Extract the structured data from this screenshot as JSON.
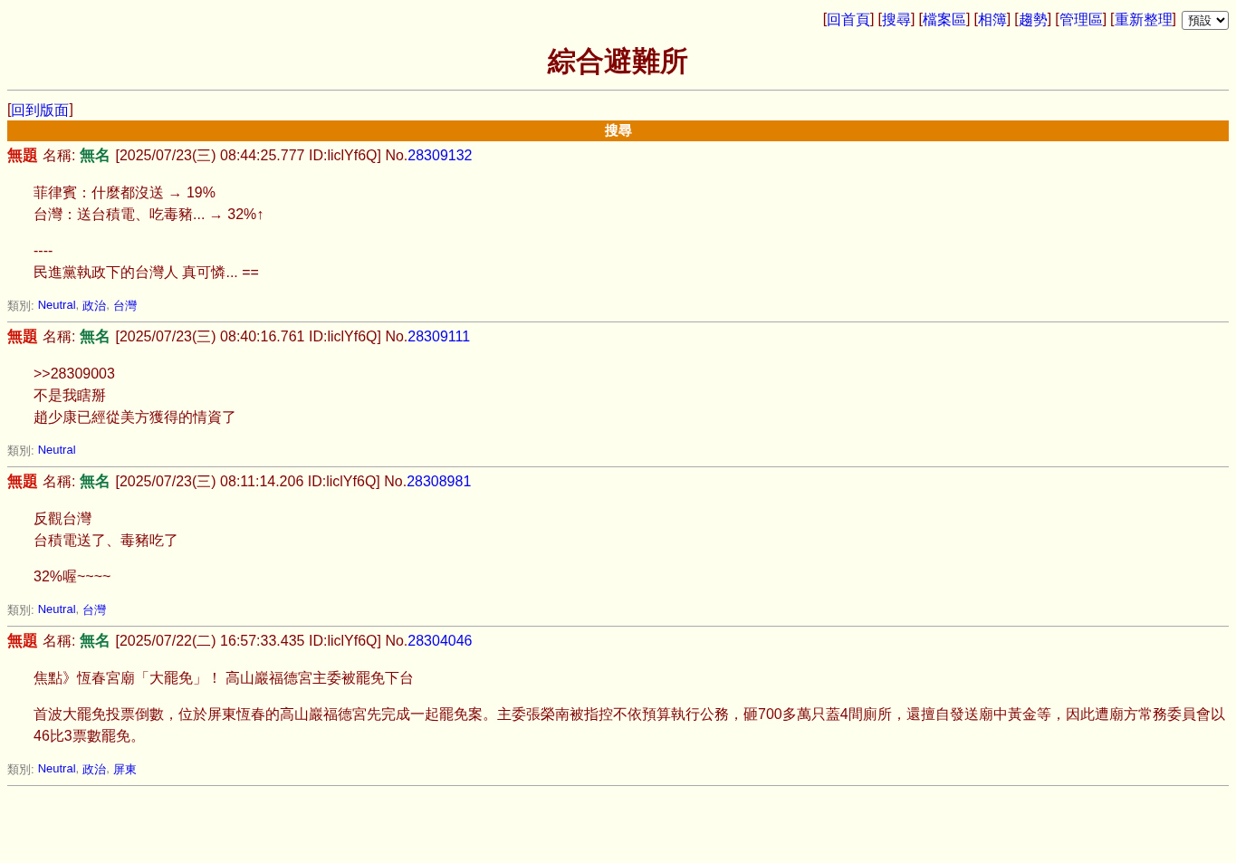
{
  "nav": {
    "links": [
      {
        "left": "[",
        "label": "回首頁",
        "right": "]"
      },
      {
        "left": "[",
        "label": "搜尋",
        "right": "]"
      },
      {
        "left": "[",
        "label": "檔案區",
        "right": "]"
      },
      {
        "left": "[",
        "label": "相簿",
        "right": "]"
      },
      {
        "left": "[",
        "label": "趨勢",
        "right": "]"
      },
      {
        "left": "[",
        "label": "管理區",
        "right": "]"
      },
      {
        "left": "[",
        "label": "重新整理",
        "right": "]"
      }
    ],
    "style_select": {
      "value": "預設"
    }
  },
  "title": "綜合避難所",
  "back": {
    "left": "[",
    "label": "回到版面",
    "right": "]"
  },
  "bar_title": "搜尋",
  "posts": [
    {
      "subject": "無題",
      "name_label": "名稱:",
      "name": "無名",
      "meta": "[2025/07/23(三) 08:44:25.777 ID:liclYf6Q] No.",
      "number": "28309132",
      "paragraphs": [
        [
          "菲律賓：什麼都沒送 → 19%",
          "台灣：送台積電、吃毒豬... → 32%↑"
        ],
        [
          "----",
          "民進黨執政下的台灣人 真可憐... =="
        ]
      ],
      "category_label": "類別:",
      "tags": [
        {
          "label": "Neutral",
          "sep": ","
        },
        {
          "label": "政治",
          "sep": ","
        },
        {
          "label": "台灣"
        }
      ]
    },
    {
      "subject": "無題",
      "name_label": "名稱:",
      "name": "無名",
      "meta": "[2025/07/23(三) 08:40:16.761 ID:liclYf6Q] No.",
      "number": "28309111",
      "paragraphs": [
        [
          ">>28309003",
          "不是我瞎掰",
          "趙少康已經從美方獲得的情資了"
        ]
      ],
      "category_label": "類別:",
      "tags": [
        {
          "label": "Neutral"
        }
      ]
    },
    {
      "subject": "無題",
      "name_label": "名稱:",
      "name": "無名",
      "meta": "[2025/07/23(三) 08:11:14.206 ID:liclYf6Q] No.",
      "number": "28308981",
      "paragraphs": [
        [
          "反觀台灣",
          "台積電送了、毒豬吃了"
        ],
        [
          "32%喔~~~~"
        ]
      ],
      "category_label": "類別:",
      "tags": [
        {
          "label": "Neutral",
          "sep": ","
        },
        {
          "label": "台灣"
        }
      ]
    },
    {
      "subject": "無題",
      "name_label": "名稱:",
      "name": "無名",
      "meta": "[2025/07/22(二) 16:57:33.435 ID:liclYf6Q] No.",
      "number": "28304046",
      "paragraphs": [
        [
          "焦點》恆春宮廟「大罷免」！ 高山巖福德宮主委被罷免下台"
        ],
        [
          "首波大罷免投票倒數，位於屏東恆春的高山巖福德宮先完成一起罷免案。主委張榮南被指控不依預算執行公務，砸700多萬只蓋4間廁所，還擅自發送廟中黃金等，因此遭廟方常務委員會以46比3票數罷免。"
        ]
      ],
      "category_label": "類別:",
      "tags": [
        {
          "label": "Neutral",
          "sep": ","
        },
        {
          "label": "政治",
          "sep": ","
        },
        {
          "label": "屏東"
        }
      ]
    }
  ]
}
